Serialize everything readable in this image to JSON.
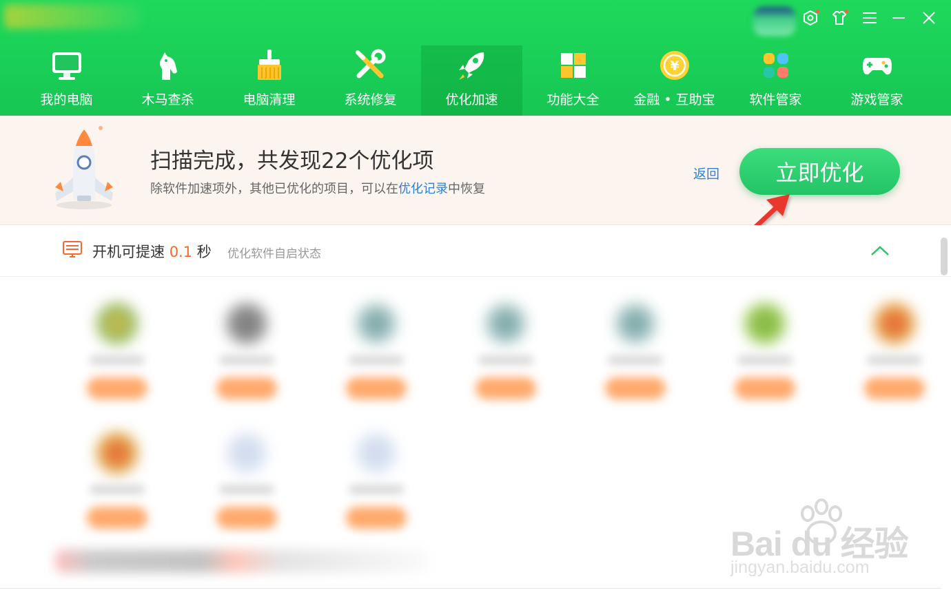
{
  "nav": {
    "items": [
      {
        "label": "我的电脑",
        "active": false
      },
      {
        "label": "木马查杀",
        "active": false
      },
      {
        "label": "电脑清理",
        "active": false
      },
      {
        "label": "系统修复",
        "active": false
      },
      {
        "label": "优化加速",
        "active": true
      },
      {
        "label": "功能大全",
        "active": false
      },
      {
        "label": "金融 • 互助宝",
        "active": false
      },
      {
        "label": "软件管家",
        "active": false
      },
      {
        "label": "游戏管家",
        "active": false
      }
    ]
  },
  "window_controls": [
    "settings-icon",
    "skin-icon",
    "menu-icon",
    "minimize-icon",
    "close-icon"
  ],
  "banner": {
    "title": "扫描完成，共发现22个优化项",
    "subtitle_prefix": "除软件加速项外，其他已优化的项目，可以在",
    "subtitle_link": "优化记录",
    "subtitle_suffix": "中恢复",
    "back_label": "返回",
    "optimize_label": "立即优化"
  },
  "section": {
    "title_prefix": "开机可提速",
    "title_value": "0.1",
    "title_unit": "秒",
    "hint": "优化软件自启状态"
  },
  "watermark": {
    "logo_text": "Bai du 经验",
    "url": "jingyan.baidu.com"
  },
  "colors": {
    "brand_green": "#1ed95c",
    "button_green": "#2fd070",
    "accent_orange": "#f46a2c",
    "link_blue": "#2d7fd9",
    "annotation_red": "#e8372f"
  }
}
